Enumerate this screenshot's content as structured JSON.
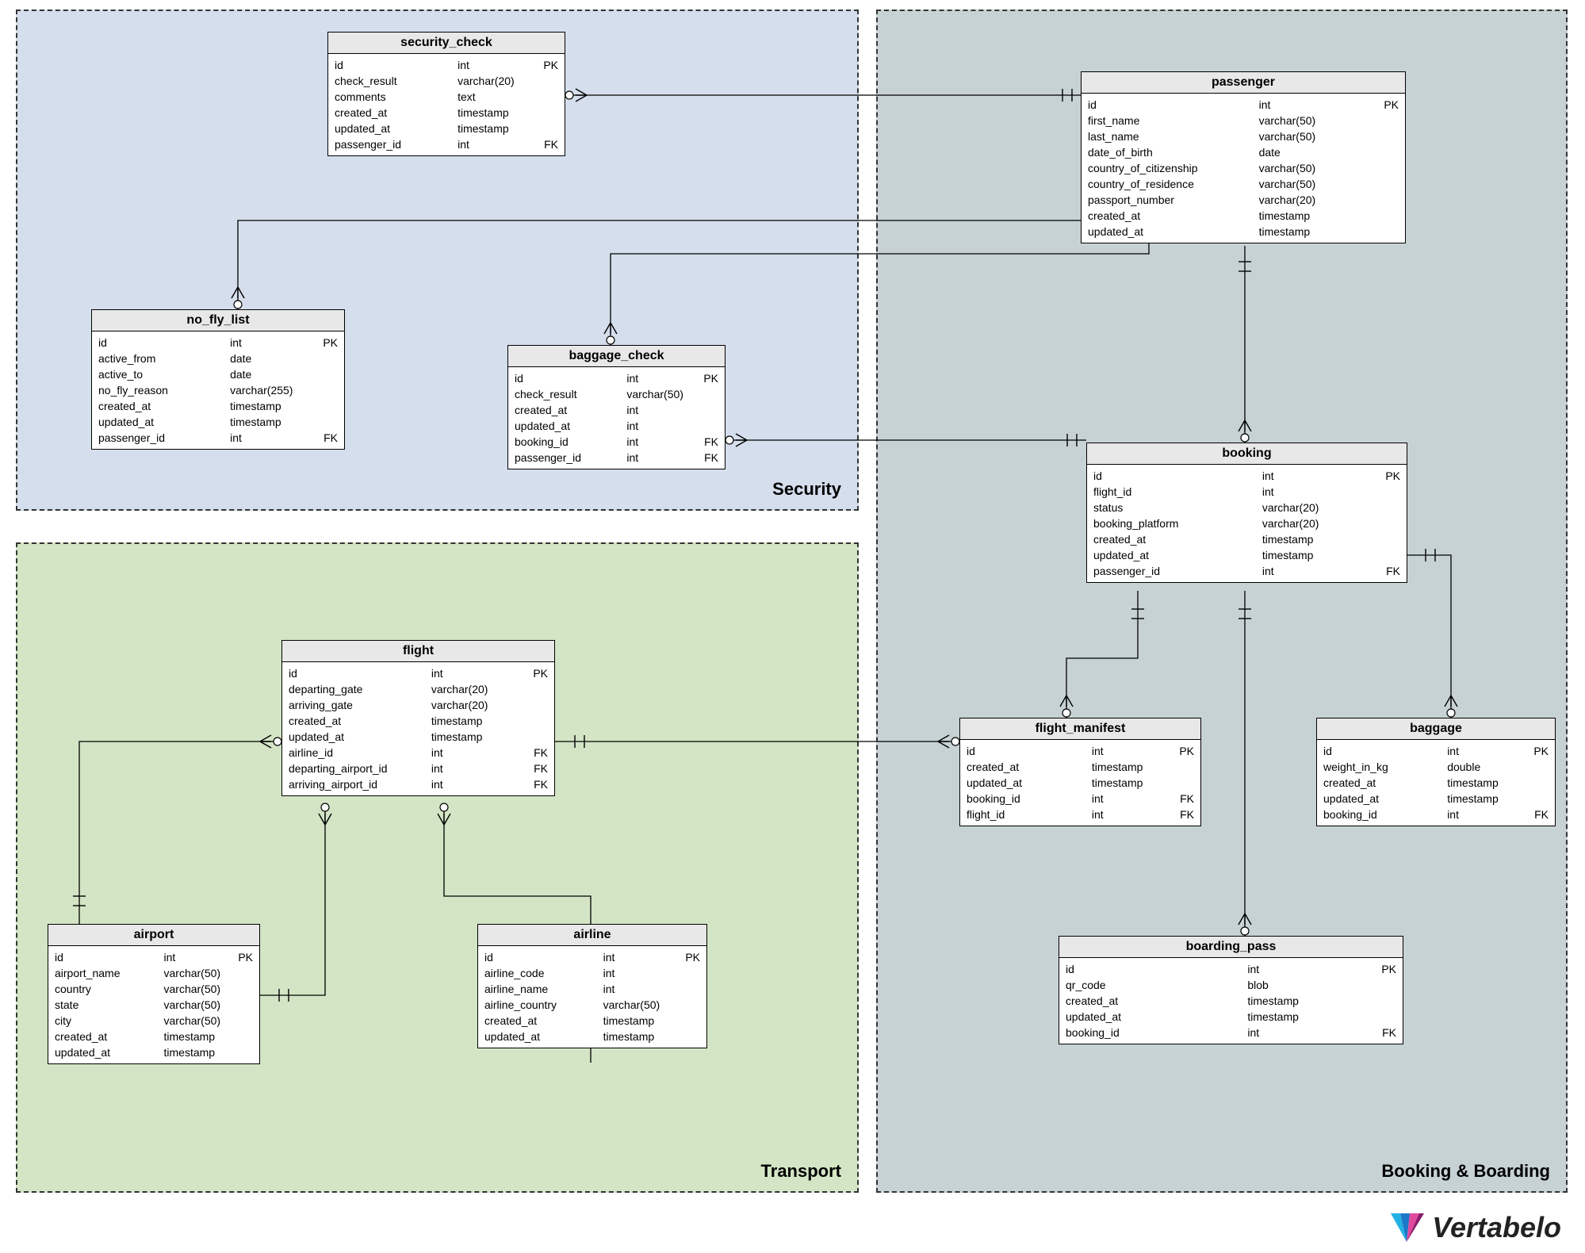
{
  "regions": {
    "security": {
      "label": "Security"
    },
    "transport": {
      "label": "Transport"
    },
    "booking": {
      "label": "Booking & Boarding"
    }
  },
  "logo": {
    "text": "Vertabelo"
  },
  "entities": {
    "security_check": {
      "title": "security_check",
      "cols": [
        {
          "n": "id",
          "t": "int",
          "k": "PK"
        },
        {
          "n": "check_result",
          "t": "varchar(20)",
          "k": ""
        },
        {
          "n": "comments",
          "t": "text",
          "k": ""
        },
        {
          "n": "created_at",
          "t": "timestamp",
          "k": ""
        },
        {
          "n": "updated_at",
          "t": "timestamp",
          "k": ""
        },
        {
          "n": "passenger_id",
          "t": "int",
          "k": "FK"
        }
      ]
    },
    "no_fly_list": {
      "title": "no_fly_list",
      "cols": [
        {
          "n": "id",
          "t": "int",
          "k": "PK"
        },
        {
          "n": "active_from",
          "t": "date",
          "k": ""
        },
        {
          "n": "active_to",
          "t": "date",
          "k": ""
        },
        {
          "n": "no_fly_reason",
          "t": "varchar(255)",
          "k": ""
        },
        {
          "n": "created_at",
          "t": "timestamp",
          "k": ""
        },
        {
          "n": "updated_at",
          "t": "timestamp",
          "k": ""
        },
        {
          "n": "passenger_id",
          "t": "int",
          "k": "FK"
        }
      ]
    },
    "baggage_check": {
      "title": "baggage_check",
      "cols": [
        {
          "n": "id",
          "t": "int",
          "k": "PK"
        },
        {
          "n": "check_result",
          "t": "varchar(50)",
          "k": ""
        },
        {
          "n": "created_at",
          "t": "int",
          "k": ""
        },
        {
          "n": "updated_at",
          "t": "int",
          "k": ""
        },
        {
          "n": "booking_id",
          "t": "int",
          "k": "FK"
        },
        {
          "n": "passenger_id",
          "t": "int",
          "k": "FK"
        }
      ]
    },
    "passenger": {
      "title": "passenger",
      "cols": [
        {
          "n": "id",
          "t": "int",
          "k": "PK"
        },
        {
          "n": "first_name",
          "t": "varchar(50)",
          "k": ""
        },
        {
          "n": "last_name",
          "t": "varchar(50)",
          "k": ""
        },
        {
          "n": "date_of_birth",
          "t": "date",
          "k": ""
        },
        {
          "n": "country_of_citizenship",
          "t": "varchar(50)",
          "k": ""
        },
        {
          "n": "country_of_residence",
          "t": "varchar(50)",
          "k": ""
        },
        {
          "n": "passport_number",
          "t": "varchar(20)",
          "k": ""
        },
        {
          "n": "created_at",
          "t": "timestamp",
          "k": ""
        },
        {
          "n": "updated_at",
          "t": "timestamp",
          "k": ""
        }
      ]
    },
    "booking": {
      "title": "booking",
      "cols": [
        {
          "n": "id",
          "t": "int",
          "k": "PK"
        },
        {
          "n": "flight_id",
          "t": "int",
          "k": ""
        },
        {
          "n": "status",
          "t": "varchar(20)",
          "k": ""
        },
        {
          "n": "booking_platform",
          "t": "varchar(20)",
          "k": ""
        },
        {
          "n": "created_at",
          "t": "timestamp",
          "k": ""
        },
        {
          "n": "updated_at",
          "t": "timestamp",
          "k": ""
        },
        {
          "n": "passenger_id",
          "t": "int",
          "k": "FK"
        }
      ]
    },
    "flight_manifest": {
      "title": "flight_manifest",
      "cols": [
        {
          "n": "id",
          "t": "int",
          "k": "PK"
        },
        {
          "n": "created_at",
          "t": "timestamp",
          "k": ""
        },
        {
          "n": "updated_at",
          "t": "timestamp",
          "k": ""
        },
        {
          "n": "booking_id",
          "t": "int",
          "k": "FK"
        },
        {
          "n": "flight_id",
          "t": "int",
          "k": "FK"
        }
      ]
    },
    "baggage": {
      "title": "baggage",
      "cols": [
        {
          "n": "id",
          "t": "int",
          "k": "PK"
        },
        {
          "n": "weight_in_kg",
          "t": "double",
          "k": ""
        },
        {
          "n": "created_at",
          "t": "timestamp",
          "k": ""
        },
        {
          "n": "updated_at",
          "t": "timestamp",
          "k": ""
        },
        {
          "n": "booking_id",
          "t": "int",
          "k": "FK"
        }
      ]
    },
    "boarding_pass": {
      "title": "boarding_pass",
      "cols": [
        {
          "n": "id",
          "t": "int",
          "k": "PK"
        },
        {
          "n": "qr_code",
          "t": "blob",
          "k": ""
        },
        {
          "n": "created_at",
          "t": "timestamp",
          "k": ""
        },
        {
          "n": "updated_at",
          "t": "timestamp",
          "k": ""
        },
        {
          "n": "booking_id",
          "t": "int",
          "k": "FK"
        }
      ]
    },
    "flight": {
      "title": "flight",
      "cols": [
        {
          "n": "id",
          "t": "int",
          "k": "PK"
        },
        {
          "n": "departing_gate",
          "t": "varchar(20)",
          "k": ""
        },
        {
          "n": "arriving_gate",
          "t": "varchar(20)",
          "k": ""
        },
        {
          "n": "created_at",
          "t": "timestamp",
          "k": ""
        },
        {
          "n": "updated_at",
          "t": "timestamp",
          "k": ""
        },
        {
          "n": "airline_id",
          "t": "int",
          "k": "FK"
        },
        {
          "n": "departing_airport_id",
          "t": "int",
          "k": "FK"
        },
        {
          "n": "arriving_airport_id",
          "t": "int",
          "k": "FK"
        }
      ]
    },
    "airport": {
      "title": "airport",
      "cols": [
        {
          "n": "id",
          "t": "int",
          "k": "PK"
        },
        {
          "n": "airport_name",
          "t": "varchar(50)",
          "k": ""
        },
        {
          "n": "country",
          "t": "varchar(50)",
          "k": ""
        },
        {
          "n": "state",
          "t": "varchar(50)",
          "k": ""
        },
        {
          "n": "city",
          "t": "varchar(50)",
          "k": ""
        },
        {
          "n": "created_at",
          "t": "timestamp",
          "k": ""
        },
        {
          "n": "updated_at",
          "t": "timestamp",
          "k": ""
        }
      ]
    },
    "airline": {
      "title": "airline",
      "cols": [
        {
          "n": "id",
          "t": "int",
          "k": "PK"
        },
        {
          "n": "airline_code",
          "t": "int",
          "k": ""
        },
        {
          "n": "airline_name",
          "t": "int",
          "k": ""
        },
        {
          "n": "airline_country",
          "t": "varchar(50)",
          "k": ""
        },
        {
          "n": "created_at",
          "t": "timestamp",
          "k": ""
        },
        {
          "n": "updated_at",
          "t": "timestamp",
          "k": ""
        }
      ]
    }
  }
}
